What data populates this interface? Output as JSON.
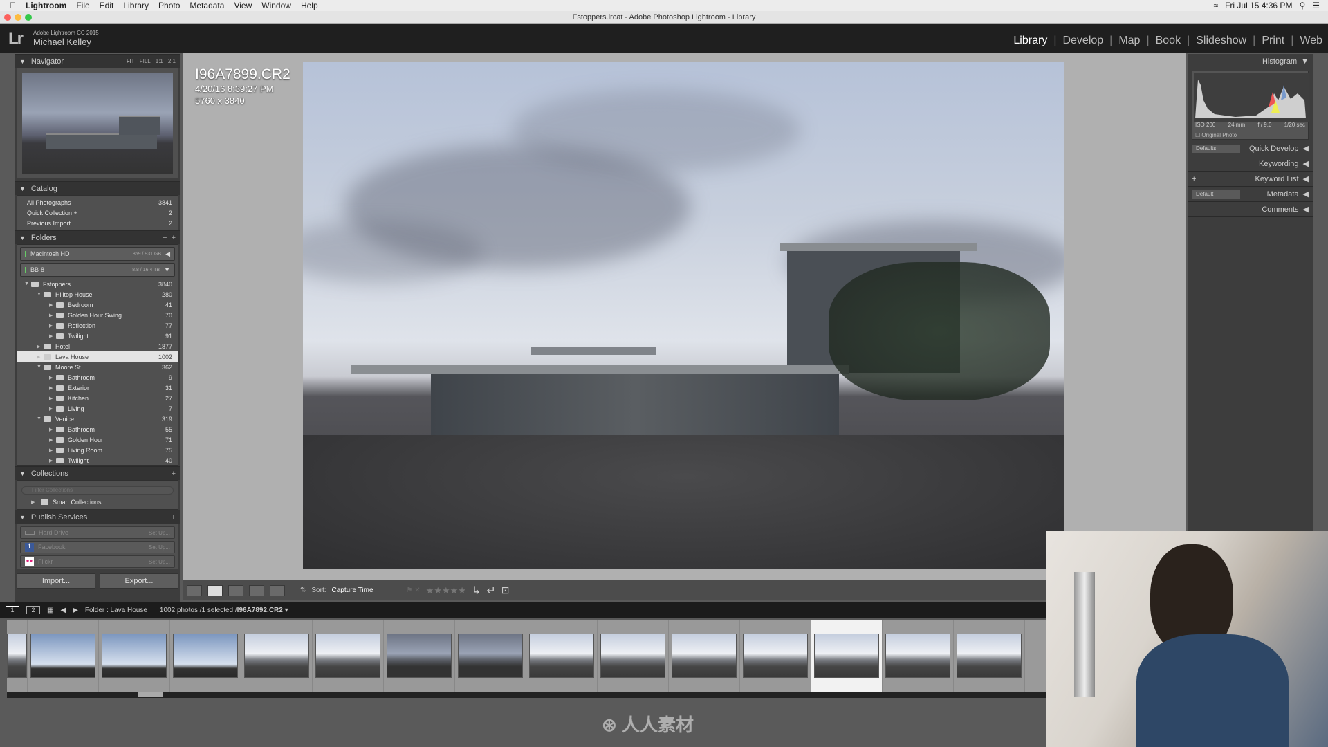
{
  "menubar": {
    "app": "Lightroom",
    "items": [
      "File",
      "Edit",
      "Library",
      "Photo",
      "Metadata",
      "View",
      "Window",
      "Help"
    ],
    "clock": "Fri Jul 15  4:36 PM"
  },
  "window": {
    "title": "Fstoppers.lrcat - Adobe Photoshop Lightroom - Library"
  },
  "identity": {
    "logo": "Lr",
    "version": "Adobe Lightroom CC 2015",
    "user": "Michael Kelley"
  },
  "modules": [
    {
      "label": "Library",
      "active": true
    },
    {
      "label": "Develop"
    },
    {
      "label": "Map"
    },
    {
      "label": "Book"
    },
    {
      "label": "Slideshow"
    },
    {
      "label": "Print"
    },
    {
      "label": "Web"
    }
  ],
  "navigator": {
    "title": "Navigator",
    "zoom": [
      "FIT",
      "FILL",
      "1:1",
      "2:1"
    ]
  },
  "catalog": {
    "title": "Catalog",
    "items": [
      {
        "label": "All Photographs",
        "count": "3841"
      },
      {
        "label": "Quick Collection +",
        "count": "2"
      },
      {
        "label": "Previous Import",
        "count": "2"
      }
    ]
  },
  "folders": {
    "title": "Folders",
    "volumes": [
      {
        "name": "Macintosh HD",
        "size": "859 / 931 GB"
      },
      {
        "name": "BB-8",
        "size": "8.8 / 16.4 TB"
      }
    ],
    "tree": [
      {
        "label": "Fstoppers",
        "count": "3840",
        "depth": 0,
        "open": true
      },
      {
        "label": "Hilltop House",
        "count": "280",
        "depth": 1,
        "open": true
      },
      {
        "label": "Bedroom",
        "count": "41",
        "depth": 2
      },
      {
        "label": "Golden Hour Swing",
        "count": "70",
        "depth": 2
      },
      {
        "label": "Reflection",
        "count": "77",
        "depth": 2
      },
      {
        "label": "Twilight",
        "count": "91",
        "depth": 2
      },
      {
        "label": "Hotel",
        "count": "1877",
        "depth": 1
      },
      {
        "label": "Lava House",
        "count": "1002",
        "depth": 1,
        "selected": true
      },
      {
        "label": "Moore St",
        "count": "362",
        "depth": 1,
        "open": true
      },
      {
        "label": "Bathroom",
        "count": "9",
        "depth": 2
      },
      {
        "label": "Exterior",
        "count": "31",
        "depth": 2
      },
      {
        "label": "Kitchen",
        "count": "27",
        "depth": 2
      },
      {
        "label": "Living",
        "count": "7",
        "depth": 2
      },
      {
        "label": "Venice",
        "count": "319",
        "depth": 1,
        "open": true
      },
      {
        "label": "Bathroom",
        "count": "55",
        "depth": 2
      },
      {
        "label": "Golden Hour",
        "count": "71",
        "depth": 2
      },
      {
        "label": "Living Room",
        "count": "75",
        "depth": 2
      },
      {
        "label": "Twilight",
        "count": "40",
        "depth": 2
      }
    ]
  },
  "collections": {
    "title": "Collections",
    "filter_placeholder": "Filter Collections",
    "items": [
      "Smart Collections"
    ]
  },
  "publish": {
    "title": "Publish Services",
    "services": [
      {
        "name": "Hard Drive",
        "action": "Set Up..."
      },
      {
        "name": "Facebook",
        "action": "Set Up..."
      },
      {
        "name": "Flickr",
        "action": "Set Up..."
      }
    ]
  },
  "buttons": {
    "import": "Import...",
    "export": "Export..."
  },
  "photo": {
    "filename": "I96A7899.CR2",
    "datetime": "4/20/16 8:39:27 PM",
    "dimensions": "5760 x 3840"
  },
  "toolbar": {
    "sort_label": "Sort:",
    "sort_value": "Capture Time",
    "stars": "★★★★★"
  },
  "filmstrip": {
    "pages": [
      "1",
      "2"
    ],
    "source": "Folder : Lava House",
    "status": "1002 photos /1 selected /",
    "selected_file": "I96A7892.CR2",
    "thumb_count": 15,
    "selected_index": 12
  },
  "histogram": {
    "title": "Histogram",
    "iso": "ISO 200",
    "focal": "24 mm",
    "aperture": "f / 9.0",
    "shutter": "1/20 sec",
    "original_photo": "Original Photo"
  },
  "right_panels": [
    {
      "title": "Quick Develop",
      "preset": "Defaults"
    },
    {
      "title": "Keywording"
    },
    {
      "title": "Keyword List",
      "plus": "+"
    },
    {
      "title": "Metadata",
      "preset": "Default"
    },
    {
      "title": "Comments"
    }
  ],
  "watermark": "人人素材"
}
